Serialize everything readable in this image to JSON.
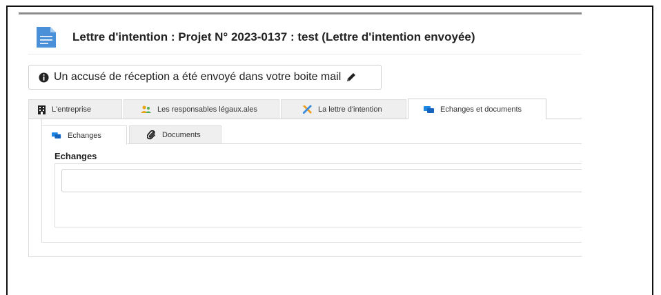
{
  "page": {
    "title": "Lettre d'intention : Projet N° 2023-0137 : test (Lettre d'intention envoyée)",
    "doc_icon": "document-icon",
    "accent": "#1e88e5"
  },
  "alert": {
    "icon": "info-icon",
    "text": "Un accusé de réception a été envoyé dans votre boite mail",
    "action_icon": "pencil-icon"
  },
  "main_tabs": [
    {
      "label": "L'entreprise",
      "icon": "building-icon",
      "active": false
    },
    {
      "label": "Les responsables légaux.ales",
      "icon": "users-icon",
      "active": false
    },
    {
      "label": "La lettre d'intention",
      "icon": "tools-icon",
      "active": false
    },
    {
      "label": "Echanges et documents",
      "icon": "comments-icon",
      "active": true
    }
  ],
  "sub_tabs": [
    {
      "label": "Echanges",
      "icon": "comments-icon",
      "active": true
    },
    {
      "label": "Documents",
      "icon": "paperclip-icon",
      "active": false
    }
  ],
  "echanges": {
    "title": "Echanges",
    "input_value": ""
  }
}
